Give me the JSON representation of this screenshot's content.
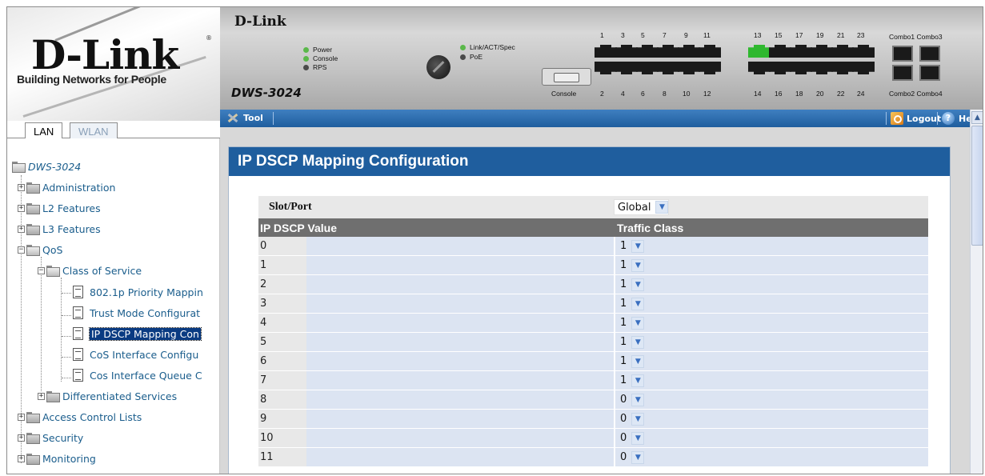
{
  "logo": {
    "brand": "D-Link",
    "registered": "®",
    "tagline": "Building Networks for People"
  },
  "tabs": [
    {
      "label": "LAN",
      "active": true
    },
    {
      "label": "WLAN",
      "active": false
    }
  ],
  "device": {
    "brand": "D-Link",
    "model": "DWS-3024",
    "leds": [
      "Power",
      "Console",
      "RPS"
    ],
    "leds2": [
      "Link/ACT/Spec",
      "PoE"
    ],
    "console_label": "Console",
    "top_port_numbers": [
      "1",
      "3",
      "5",
      "7",
      "9",
      "11",
      "13",
      "15",
      "17",
      "19",
      "21",
      "23"
    ],
    "bottom_port_numbers": [
      "2",
      "4",
      "6",
      "8",
      "10",
      "12",
      "14",
      "16",
      "18",
      "20",
      "22",
      "24"
    ],
    "combo_top": "Combo1 Combo3",
    "combo_bottom": "Combo2 Combo4"
  },
  "toolbar": {
    "tool_label": "Tool",
    "logout_label": "Logout",
    "help_label": "Help"
  },
  "tree": {
    "root": "DWS-3024",
    "items": [
      {
        "label": "Administration"
      },
      {
        "label": "L2 Features"
      },
      {
        "label": "L3 Features"
      },
      {
        "label": "QoS"
      },
      {
        "label": "Class of Service"
      },
      {
        "label": "802.1p Priority Mappin"
      },
      {
        "label": "Trust Mode Configurat"
      },
      {
        "label": "IP DSCP Mapping Con"
      },
      {
        "label": "CoS Interface Configu"
      },
      {
        "label": "Cos Interface Queue C"
      },
      {
        "label": "Differentiated Services"
      },
      {
        "label": "Access Control Lists"
      },
      {
        "label": "Security"
      },
      {
        "label": "Monitoring"
      }
    ]
  },
  "panel": {
    "title": "IP DSCP Mapping Configuration",
    "slot_port_label": "Slot/Port",
    "slot_port_value": "Global",
    "col_dscp": "IP DSCP Value",
    "col_traffic": "Traffic Class",
    "rows": [
      {
        "dscp": "0",
        "tc": "1"
      },
      {
        "dscp": "1",
        "tc": "1"
      },
      {
        "dscp": "2",
        "tc": "1"
      },
      {
        "dscp": "3",
        "tc": "1"
      },
      {
        "dscp": "4",
        "tc": "1"
      },
      {
        "dscp": "5",
        "tc": "1"
      },
      {
        "dscp": "6",
        "tc": "1"
      },
      {
        "dscp": "7",
        "tc": "1"
      },
      {
        "dscp": "8",
        "tc": "0"
      },
      {
        "dscp": "9",
        "tc": "0"
      },
      {
        "dscp": "10",
        "tc": "0"
      },
      {
        "dscp": "11",
        "tc": "0"
      }
    ]
  }
}
